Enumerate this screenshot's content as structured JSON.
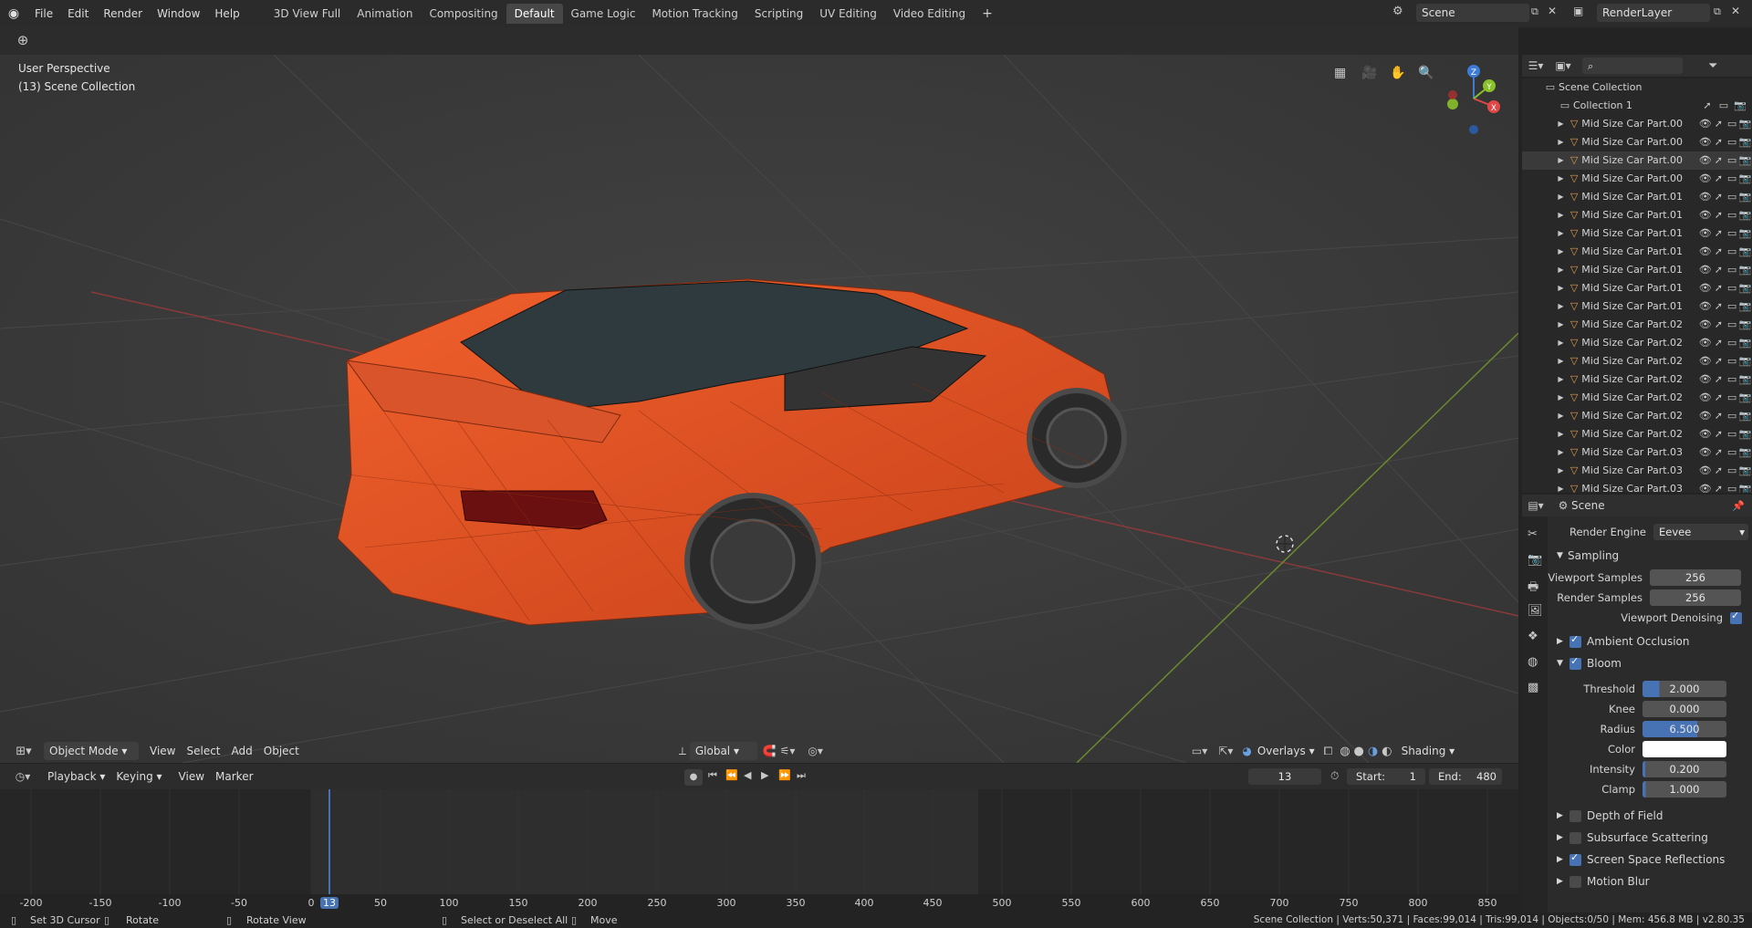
{
  "menu": [
    "File",
    "Edit",
    "Render",
    "Window",
    "Help"
  ],
  "workspaces": [
    {
      "label": "3D View Full",
      "active": false
    },
    {
      "label": "Animation",
      "active": false
    },
    {
      "label": "Compositing",
      "active": false
    },
    {
      "label": "Default",
      "active": true
    },
    {
      "label": "Game Logic",
      "active": false
    },
    {
      "label": "Motion Tracking",
      "active": false
    },
    {
      "label": "Scripting",
      "active": false
    },
    {
      "label": "UV Editing",
      "active": false
    },
    {
      "label": "Video Editing",
      "active": false
    }
  ],
  "add_workspace": "+",
  "scene_name": "Scene",
  "render_layer": "RenderLayer",
  "viewport": {
    "perspective": "User Perspective",
    "collection": "(13) Scene Collection",
    "mode": "Object Mode",
    "menus": [
      "View",
      "Select",
      "Add",
      "Object"
    ],
    "orientation": "Global",
    "overlays": "Overlays",
    "shading": "Shading",
    "gizmo_z": "Z",
    "gizmo_y": "Y",
    "gizmo_x": "X"
  },
  "outliner": {
    "root": "Scene Collection",
    "collection": "Collection 1",
    "items": [
      "Mid Size Car Part.00",
      "Mid Size Car Part.00",
      "Mid Size Car Part.00",
      "Mid Size Car Part.00",
      "Mid Size Car Part.01",
      "Mid Size Car Part.01",
      "Mid Size Car Part.01",
      "Mid Size Car Part.01",
      "Mid Size Car Part.01",
      "Mid Size Car Part.01",
      "Mid Size Car Part.01",
      "Mid Size Car Part.02",
      "Mid Size Car Part.02",
      "Mid Size Car Part.02",
      "Mid Size Car Part.02",
      "Mid Size Car Part.02",
      "Mid Size Car Part.02",
      "Mid Size Car Part.02",
      "Mid Size Car Part.03",
      "Mid Size Car Part.03",
      "Mid Size Car Part.03"
    ],
    "selected_index": 2
  },
  "props": {
    "title": "Scene",
    "render_engine_label": "Render Engine",
    "render_engine": "Eevee",
    "sampling": "Sampling",
    "viewport_samples_label": "Viewport Samples",
    "viewport_samples": "256",
    "render_samples_label": "Render Samples",
    "render_samples": "256",
    "denoise_label": "Viewport Denoising",
    "ao": "Ambient Occlusion",
    "bloom": "Bloom",
    "threshold_label": "Threshold",
    "threshold": "2.000",
    "knee_label": "Knee",
    "knee": "0.000",
    "radius_label": "Radius",
    "radius": "6.500",
    "color_label": "Color",
    "intensity_label": "Intensity",
    "intensity": "0.200",
    "clamp_label": "Clamp",
    "clamp": "1.000",
    "dof": "Depth of Field",
    "sss": "Subsurface Scattering",
    "ssr": "Screen Space Reflections",
    "motion_blur": "Motion Blur"
  },
  "timeline": {
    "menus": [
      "Playback",
      "Keying",
      "View",
      "Marker"
    ],
    "current_frame": "13",
    "start_label": "Start:",
    "start": "1",
    "end_label": "End:",
    "end": "480",
    "ticks": [
      "-200",
      "-150",
      "-100",
      "-50",
      "0",
      "13",
      "50",
      "100",
      "150",
      "200",
      "250",
      "300",
      "350",
      "400",
      "450",
      "500",
      "550",
      "600",
      "650",
      "700",
      "750",
      "800",
      "850"
    ]
  },
  "status": {
    "cursor": "Set 3D Cursor",
    "rotate": "Rotate",
    "rotate_view": "Rotate View",
    "select": "Select or Deselect All",
    "move": "Move",
    "stats": "Scene Collection | Verts:50,371 | Faces:99,014 | Tris:99,014 | Objects:0/50 | Mem: 456.8 MB | v2.80.35"
  }
}
